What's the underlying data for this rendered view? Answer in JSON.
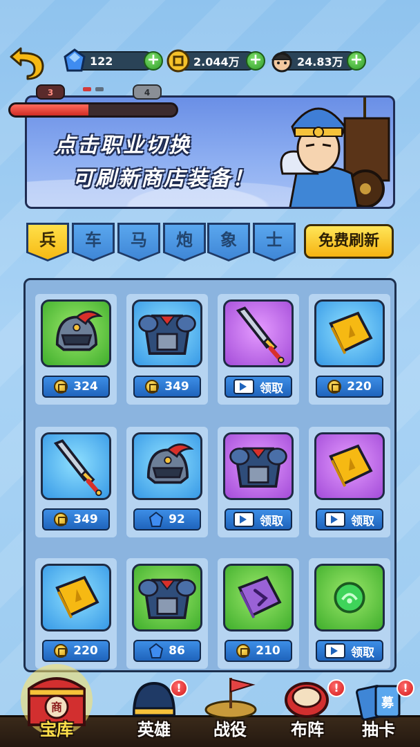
{
  "top_bar": {
    "gems": "122",
    "coins": "2.044万",
    "power": "24.83万"
  },
  "progress": {
    "current_level": "3",
    "next_level": "4",
    "fill_fraction": 0.47
  },
  "banner": {
    "line1": "点击职业切换",
    "line2": "可刷新商店装备！"
  },
  "tabs": [
    {
      "label": "兵",
      "active": true
    },
    {
      "label": "车",
      "active": false
    },
    {
      "label": "马",
      "active": false
    },
    {
      "label": "炮",
      "active": false
    },
    {
      "label": "象",
      "active": false
    },
    {
      "label": "士",
      "active": false
    }
  ],
  "refresh_label": "免费刷新",
  "shop_items": [
    {
      "item": "helmet-icon",
      "rarity": "green",
      "currency": "coin",
      "price": "324"
    },
    {
      "item": "armor-icon",
      "rarity": "blue",
      "currency": "coin",
      "price": "349"
    },
    {
      "item": "sword-icon",
      "rarity": "purple",
      "currency": "video",
      "price": "领取"
    },
    {
      "item": "book-icon",
      "rarity": "blue",
      "currency": "coin",
      "price": "220"
    },
    {
      "item": "sword-icon",
      "rarity": "blue",
      "currency": "coin",
      "price": "349"
    },
    {
      "item": "helmet-icon",
      "rarity": "blue",
      "currency": "gem",
      "price": "92"
    },
    {
      "item": "armor-icon",
      "rarity": "purple",
      "currency": "video",
      "price": "领取"
    },
    {
      "item": "book-icon",
      "rarity": "purple",
      "currency": "video",
      "price": "领取"
    },
    {
      "item": "book-icon",
      "rarity": "blue",
      "currency": "coin",
      "price": "220"
    },
    {
      "item": "armor-icon",
      "rarity": "green",
      "currency": "gem",
      "price": "86"
    },
    {
      "item": "skill-book-icon",
      "rarity": "green",
      "currency": "coin",
      "price": "210"
    },
    {
      "item": "green-orb-icon",
      "rarity": "green",
      "currency": "video",
      "price": "领取"
    }
  ],
  "nav": [
    {
      "label": "宝库",
      "active": true,
      "alert": false
    },
    {
      "label": "英雄",
      "active": false,
      "alert": true
    },
    {
      "label": "战役",
      "active": false,
      "alert": false
    },
    {
      "label": "布阵",
      "active": false,
      "alert": true
    },
    {
      "label": "抽卡",
      "active": false,
      "alert": true
    }
  ],
  "labels": {
    "treasure_seal": "商",
    "gacha_seal": "募",
    "alert_mark": "!"
  }
}
